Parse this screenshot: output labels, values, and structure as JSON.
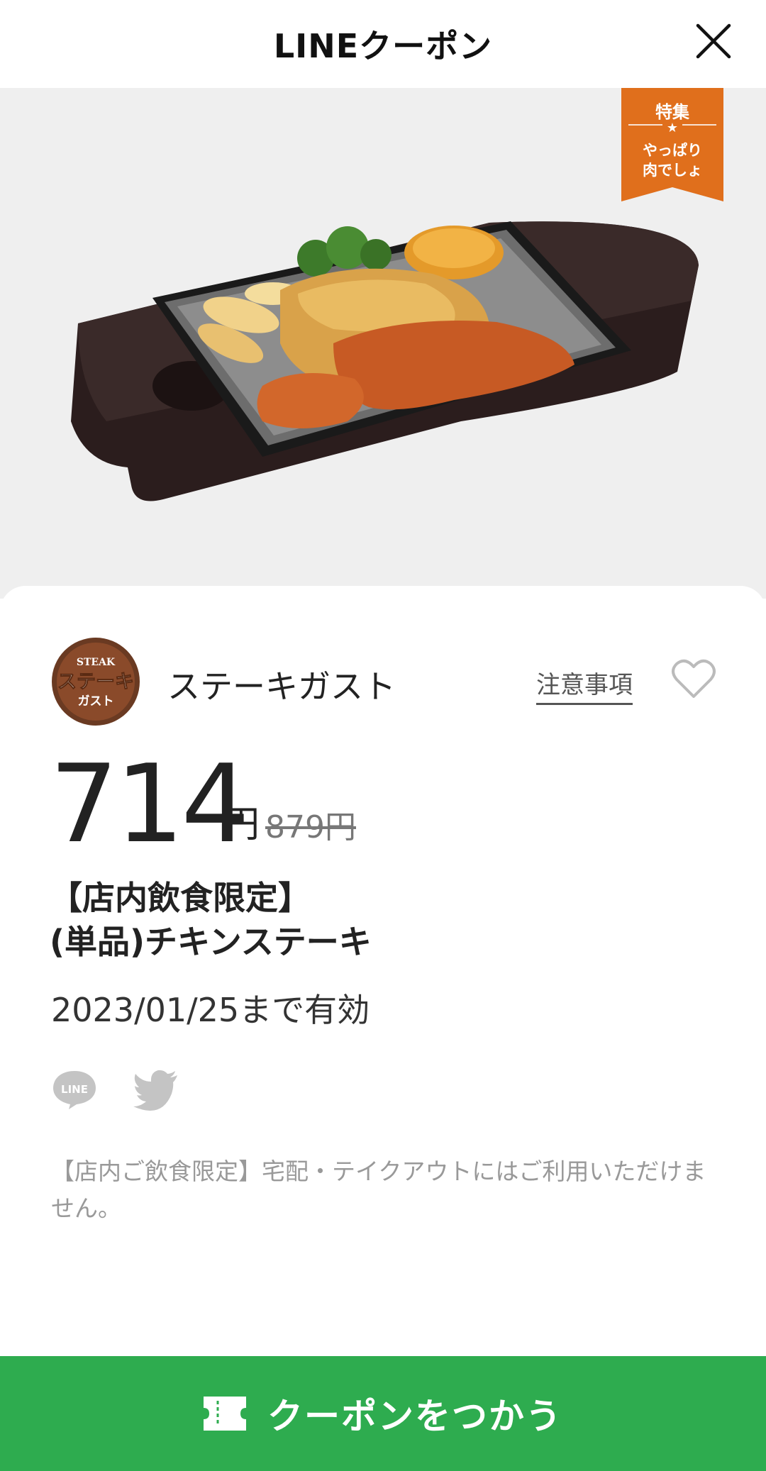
{
  "header": {
    "title": "LINEクーポン"
  },
  "hero": {
    "badge": {
      "top": "特集",
      "star": "★",
      "line1": "やっぱり",
      "line2": "肉でしょ"
    }
  },
  "shop": {
    "name": "ステーキガスト",
    "logo_text_top": "STEAK",
    "logo_text_main": "ステーキ",
    "logo_text_bottom": "ガスト"
  },
  "links": {
    "notice": "注意事項"
  },
  "price": {
    "current": "714",
    "unit": "円",
    "original": "879円"
  },
  "coupon": {
    "title_line1": "【店内飲食限定】",
    "title_line2": "(単品)チキンステーキ",
    "valid_until": "2023/01/25まで有効",
    "note": "【店内ご飲食限定】宅配・テイクアウトにはご利用いただけません。"
  },
  "share": {
    "line_label": "LINE"
  },
  "action": {
    "use_label": "クーポンをつかう"
  },
  "colors": {
    "accent": "#2eac4f",
    "badge": "#e06f1c"
  }
}
